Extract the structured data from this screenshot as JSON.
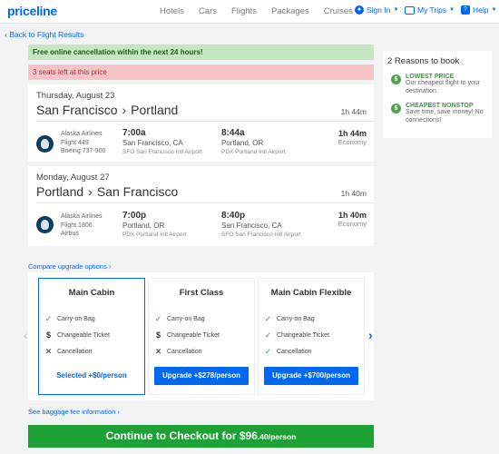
{
  "header": {
    "logo": "priceline",
    "nav": [
      "Hotels",
      "Cars",
      "Flights",
      "Packages",
      "Cruises"
    ],
    "sign_in": "Sign In",
    "my_trips": "My Trips",
    "help": "Help"
  },
  "back_link": "Back to Flight Results",
  "banners": {
    "free_cancel": "Free online cancellation within the next 24 hours!",
    "seats_left": "3 seats left at this price"
  },
  "flights": [
    {
      "date": "Thursday, August 23",
      "origin": "San Francisco",
      "destination": "Portland",
      "duration": "1h 44m",
      "airline": "Alaska Airlines",
      "flight": "Flight 449",
      "aircraft": "Boeing 737-900",
      "dep_time": "7:00a",
      "dep_city": "San Francisco, CA",
      "dep_airport": "SFO San Francisco Intl Airport",
      "arr_time": "8:44a",
      "arr_city": "Portland, OR",
      "arr_airport": "PDX Portland Intl Airport",
      "cabin": "Economy"
    },
    {
      "date": "Monday, August 27",
      "origin": "Portland",
      "destination": "San Francisco",
      "duration": "1h 40m",
      "airline": "Alaska Airlines",
      "flight": "Flight 1806",
      "aircraft": "Airbus",
      "dep_time": "7:00p",
      "dep_city": "Portland, OR",
      "dep_airport": "PDX Portland Intl Airport",
      "arr_time": "8:40p",
      "arr_city": "San Francisco, CA",
      "arr_airport": "SFO San Francisco Intl Airport",
      "cabin": "Economy"
    }
  ],
  "reasons": {
    "title": "2 Reasons to book",
    "items": [
      {
        "heading": "LOWEST PRICE",
        "body": "Our cheapest flight to your destination."
      },
      {
        "heading": "CHEAPEST NONSTOP",
        "body": "Save time, save money! No connections!"
      }
    ]
  },
  "upgrade": {
    "compare_link": "Compare upgrade options",
    "fares": [
      {
        "name": "Main Cabin",
        "features": [
          "Carry-on Bag",
          "Changeable Ticket",
          "Cancellation"
        ],
        "action": "Selected +$0/person"
      },
      {
        "name": "First Class",
        "features": [
          "Carry-on Bag",
          "Changeable Ticket",
          "Cancellation"
        ],
        "action": "Upgrade +$278/person"
      },
      {
        "name": "Main Cabin Flexible",
        "features": [
          "Carry-on Bag",
          "Changeable Ticket",
          "Cancellation"
        ],
        "action": "Upgrade +$700/person"
      }
    ]
  },
  "baggage_link": "See baggage fee information",
  "checkout": {
    "label": "Continue to Checkout for $96",
    "cents": ".40/person"
  },
  "colors": {
    "brand_blue": "#0068ef",
    "checkout_green": "#1da135",
    "banner_green": "#c4e7c2",
    "banner_red": "#f6c4c7"
  }
}
